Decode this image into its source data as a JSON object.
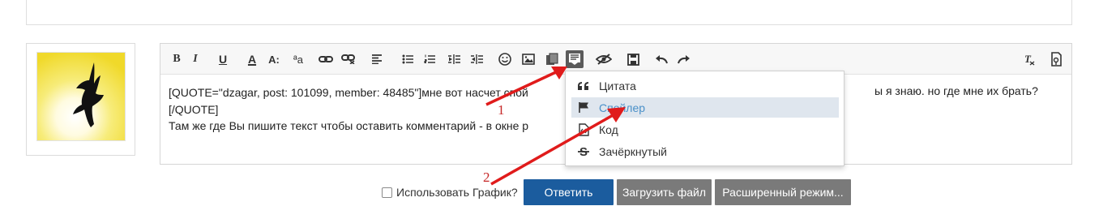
{
  "editor": {
    "text_lines": [
      "[QUOTE=\"dzagar, post: 101099, member: 48485\"]мне вот насчет спой",
      "[/QUOTE]",
      "Там же где Вы пишите текст чтобы оставить комментарий - в окне р"
    ],
    "text_line1_right": "ы я знаю. но где мне их брать?"
  },
  "toolbar": {
    "items": [
      {
        "label": "B",
        "icon": "bold-icon"
      },
      {
        "label": "I",
        "icon": "italic-icon"
      },
      {
        "label": "U",
        "icon": "underline-icon"
      },
      {
        "label": "A",
        "icon": "text-color-icon"
      },
      {
        "label": "A:",
        "icon": "font-size-icon"
      },
      {
        "label": "ªa",
        "icon": "font-family-icon"
      },
      {
        "label": "",
        "icon": "link-icon"
      },
      {
        "label": "",
        "icon": "unlink-icon"
      },
      {
        "label": "",
        "icon": "align-icon"
      },
      {
        "label": "",
        "icon": "bullet-list-icon"
      },
      {
        "label": "",
        "icon": "numbered-list-icon"
      },
      {
        "label": "",
        "icon": "outdent-icon"
      },
      {
        "label": "",
        "icon": "indent-icon"
      },
      {
        "label": "",
        "icon": "smiley-icon"
      },
      {
        "label": "",
        "icon": "image-icon"
      },
      {
        "label": "",
        "icon": "media-icon"
      },
      {
        "label": "",
        "icon": "insert-icon"
      },
      {
        "label": "",
        "icon": "hide-icon"
      },
      {
        "label": "",
        "icon": "save-icon"
      },
      {
        "label": "",
        "icon": "undo-icon"
      },
      {
        "label": "",
        "icon": "redo-icon"
      },
      {
        "label": "",
        "icon": "remove-format-icon"
      },
      {
        "label": "",
        "icon": "bbcode-toggle-icon"
      }
    ]
  },
  "dropdown": {
    "items": [
      {
        "label": "Цитата",
        "icon": "quote-icon"
      },
      {
        "label": "Спойлер",
        "icon": "flag-icon"
      },
      {
        "label": "Код",
        "icon": "code-file-icon"
      },
      {
        "label": "Зачёркнутый",
        "icon": "strikethrough-icon"
      }
    ]
  },
  "bottom": {
    "checkbox_label": "Использовать График?",
    "reply_button": "Ответить",
    "upload_button": "Загрузить файл",
    "advanced_button": "Расширенный режим..."
  },
  "annotations": [
    "1",
    "2"
  ],
  "colors": {
    "primary": "#1b5c9e",
    "grey_button": "#7a7a7a",
    "annotation_red": "#e01b1b",
    "highlight_bg": "#dfe6ee",
    "highlight_text": "#4a90c8"
  }
}
